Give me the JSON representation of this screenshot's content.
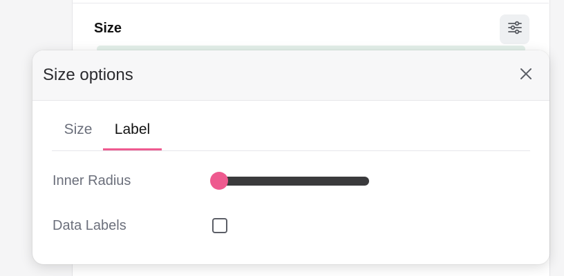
{
  "background": {
    "section_title": "Size",
    "settings_icon": "sliders-icon"
  },
  "modal": {
    "title": "Size options",
    "close_icon": "close-icon",
    "tabs": [
      {
        "label": "Size",
        "active": false
      },
      {
        "label": "Label",
        "active": true
      }
    ],
    "rows": {
      "inner_radius": {
        "label": "Inner Radius",
        "value": 0
      },
      "data_labels": {
        "label": "Data Labels",
        "checked": false
      }
    }
  },
  "colors": {
    "accent": "#ee5a8f",
    "track": "#3a3a3c"
  }
}
